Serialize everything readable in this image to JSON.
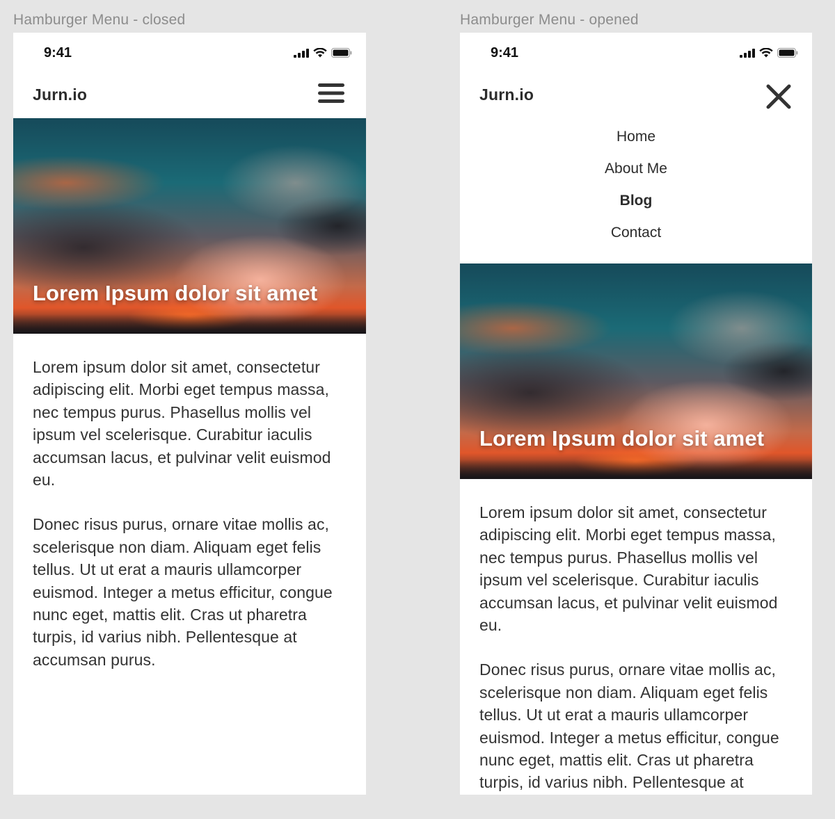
{
  "frames": [
    {
      "label": "Hamburger Menu - closed",
      "state": "closed",
      "status_bar": {
        "time": "9:41",
        "icons": [
          "cellular-signal-icon",
          "wifi-icon",
          "battery-icon"
        ]
      },
      "header": {
        "brand": "Jurn.io",
        "toggle_icon": "hamburger-icon"
      },
      "hero": {
        "title": "Lorem Ipsum dolor sit amet"
      },
      "paragraphs": [
        "Lorem ipsum dolor sit amet, consectetur adipiscing elit. Morbi eget tempus massa, nec tempus purus. Phasellus mollis vel ipsum vel scelerisque. Curabitur iaculis accumsan lacus, et pulvinar velit euismod eu.",
        "Donec risus purus, ornare vitae mollis ac, scelerisque non diam. Aliquam eget felis tellus. Ut ut erat a mauris ullamcorper euismod. Integer a metus efficitur, congue nunc eget, mattis elit. Cras ut pharetra turpis, id varius nibh. Pellentesque at accumsan purus."
      ]
    },
    {
      "label": "Hamburger Menu - opened",
      "state": "opened",
      "status_bar": {
        "time": "9:41",
        "icons": [
          "cellular-signal-icon",
          "wifi-icon",
          "battery-icon"
        ]
      },
      "header": {
        "brand": "Jurn.io",
        "toggle_icon": "close-icon"
      },
      "menu": [
        {
          "label": "Home",
          "active": false
        },
        {
          "label": "About Me",
          "active": false
        },
        {
          "label": "Blog",
          "active": true
        },
        {
          "label": "Contact",
          "active": false
        }
      ],
      "hero": {
        "title": "Lorem Ipsum dolor sit amet"
      },
      "paragraphs": [
        "Lorem ipsum dolor sit amet, consectetur adipiscing elit. Morbi eget tempus massa, nec tempus purus. Phasellus mollis vel ipsum vel scelerisque. Curabitur iaculis accumsan lacus, et pulvinar velit euismod eu.",
        "Donec risus purus, ornare vitae mollis ac, scelerisque non diam. Aliquam eget felis tellus. Ut ut erat a mauris ullamcorper euismod. Integer a metus efficitur, congue nunc eget, mattis elit. Cras ut pharetra turpis, id varius nibh. Pellentesque at accumsan purus."
      ]
    }
  ],
  "colors": {
    "canvas": "#e5e5e5",
    "text": "#333333",
    "brand": "#2c2c2c",
    "label": "#8c8c8c"
  }
}
